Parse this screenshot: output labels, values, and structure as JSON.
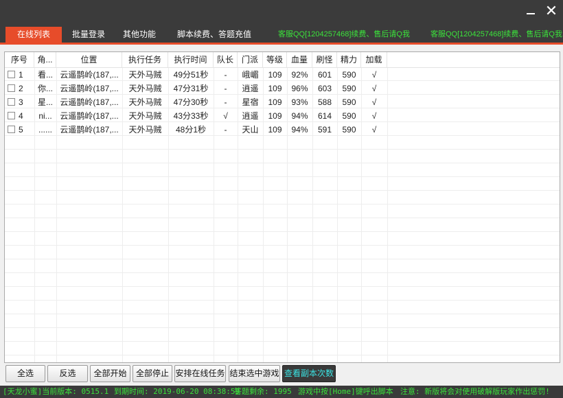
{
  "window": {
    "minimize_label": "",
    "close_label": "✕"
  },
  "tabs": [
    {
      "label": "在线列表"
    },
    {
      "label": "批量登录"
    },
    {
      "label": "其他功能"
    },
    {
      "label": "脚本续费、答题充值"
    }
  ],
  "ads": [
    "客服QQ[1204257468]续费、售后请Q我",
    "客服QQ[1204257468]续费、售后请Q我"
  ],
  "table": {
    "columns": [
      "序号",
      "角...",
      "位置",
      "执行任务",
      "执行时间",
      "队长",
      "门派",
      "等级",
      "血量",
      "刷怪",
      "精力",
      "加载"
    ],
    "rows": [
      {
        "idx": "1",
        "name": "看...",
        "location": "云遥鹊岭(187,...",
        "task": "天外马贼",
        "time": "49分51秒",
        "leader": "-",
        "sect": "峨嵋",
        "level": "109",
        "hp": "92%",
        "kills": "601",
        "energy": "590",
        "loaded": "√"
      },
      {
        "idx": "2",
        "name": "你...",
        "location": "云遥鹊岭(187,...",
        "task": "天外马贼",
        "time": "47分31秒",
        "leader": "-",
        "sect": "逍遥",
        "level": "109",
        "hp": "96%",
        "kills": "603",
        "energy": "590",
        "loaded": "√"
      },
      {
        "idx": "3",
        "name": "星...",
        "location": "云遥鹊岭(187,...",
        "task": "天外马贼",
        "time": "47分30秒",
        "leader": "-",
        "sect": "星宿",
        "level": "109",
        "hp": "93%",
        "kills": "588",
        "energy": "590",
        "loaded": "√"
      },
      {
        "idx": "4",
        "name": "ni...",
        "location": "云遥鹊岭(187,...",
        "task": "天外马贼",
        "time": "43分33秒",
        "leader": "√",
        "sect": "逍遥",
        "level": "109",
        "hp": "94%",
        "kills": "614",
        "energy": "590",
        "loaded": "√"
      },
      {
        "idx": "5",
        "name": "......",
        "location": "云遥鹊岭(187,...",
        "task": "天外马贼",
        "time": "48分1秒",
        "leader": "-",
        "sect": "天山",
        "level": "109",
        "hp": "94%",
        "kills": "591",
        "energy": "590",
        "loaded": "√"
      }
    ]
  },
  "buttons": [
    {
      "label": "全选"
    },
    {
      "label": "反选"
    },
    {
      "label": "全部开始"
    },
    {
      "label": "全部停止"
    },
    {
      "label": "安排在线任务"
    },
    {
      "label": "结束选中游戏"
    },
    {
      "label": "查看副本次数"
    }
  ],
  "status": {
    "version": "[天龙小蜜]当前版本: 0515.1",
    "expiry": "到期时间: 2019-06-20 08:38:59",
    "quiz_left": "答题剩余: 1995",
    "hotkey": "游戏中按[Home]键呼出脚本",
    "notice": "注意: 新版将会对使用破解版玩家作出惩罚!"
  },
  "colors": {
    "accent": "#e74c2a",
    "ad_text": "#3be33b",
    "status_text": "#3be33b",
    "dark_button_text": "#3be3e3"
  }
}
